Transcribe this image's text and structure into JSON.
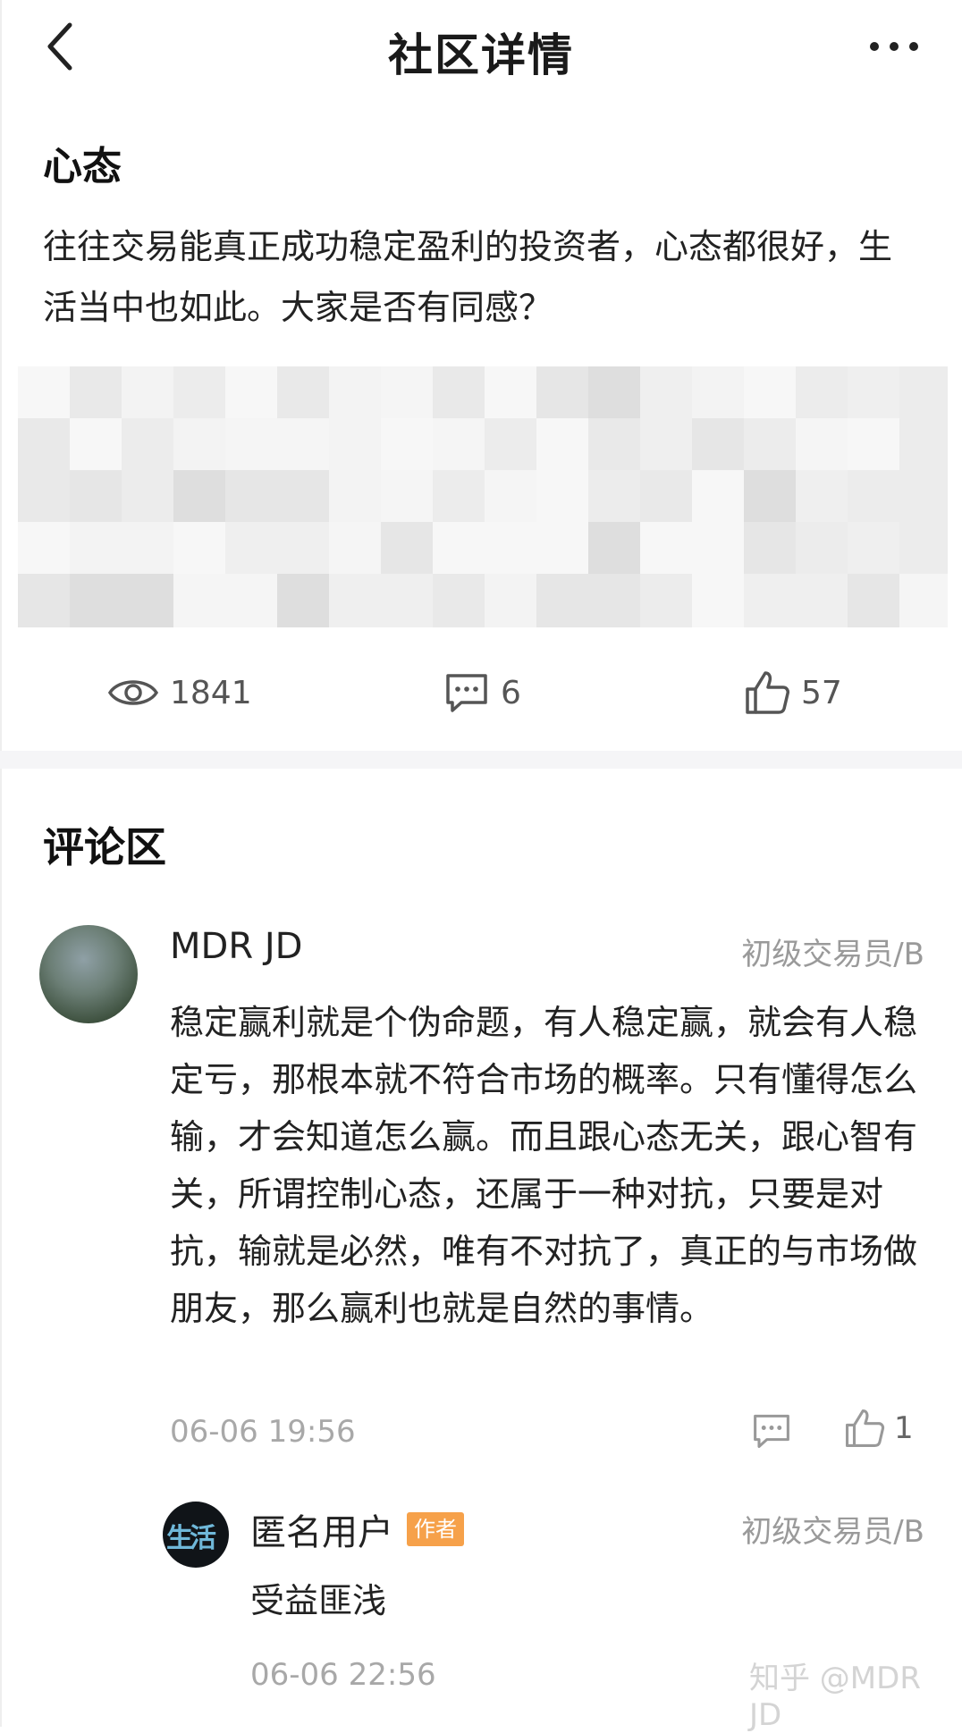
{
  "nav": {
    "title": "社区详情"
  },
  "post": {
    "title": "心态",
    "body": "往往交易能真正成功稳定盈利的投资者，心态都很好，生活当中也如此。大家是否有同感？",
    "stats": {
      "views": "1841",
      "comments": "6",
      "likes": "57"
    }
  },
  "comments_section": {
    "title": "评论区",
    "comments": [
      {
        "username": "MDR JD",
        "level": "初级交易员/B",
        "text": "稳定赢利就是个伪命题，有人稳定赢，就会有人稳定亏，那根本就不符合市场的概率。只有懂得怎么输，才会知道怎么赢。而且跟心态无关，跟心智有关，所谓控制心态，还属于一种对抗，只要是对抗，输就是必然，唯有不对抗了，真正的与市场做朋友，那么赢利也就是自然的事情。",
        "time": "06-06 19:56",
        "likes": "1",
        "replies": [
          {
            "username": "匿名用户",
            "badge": "作者",
            "avatar_text": "生活",
            "level": "初级交易员/B",
            "text": "受益匪浅",
            "time": "06-06 22:56"
          }
        ]
      }
    ]
  },
  "watermark": "知乎 @MDR JD",
  "colors": {
    "badge": "#f6a14a",
    "muted_text": "#a8a8a8",
    "level_text": "#9a9a9a",
    "divider": "#f5f5f7"
  }
}
